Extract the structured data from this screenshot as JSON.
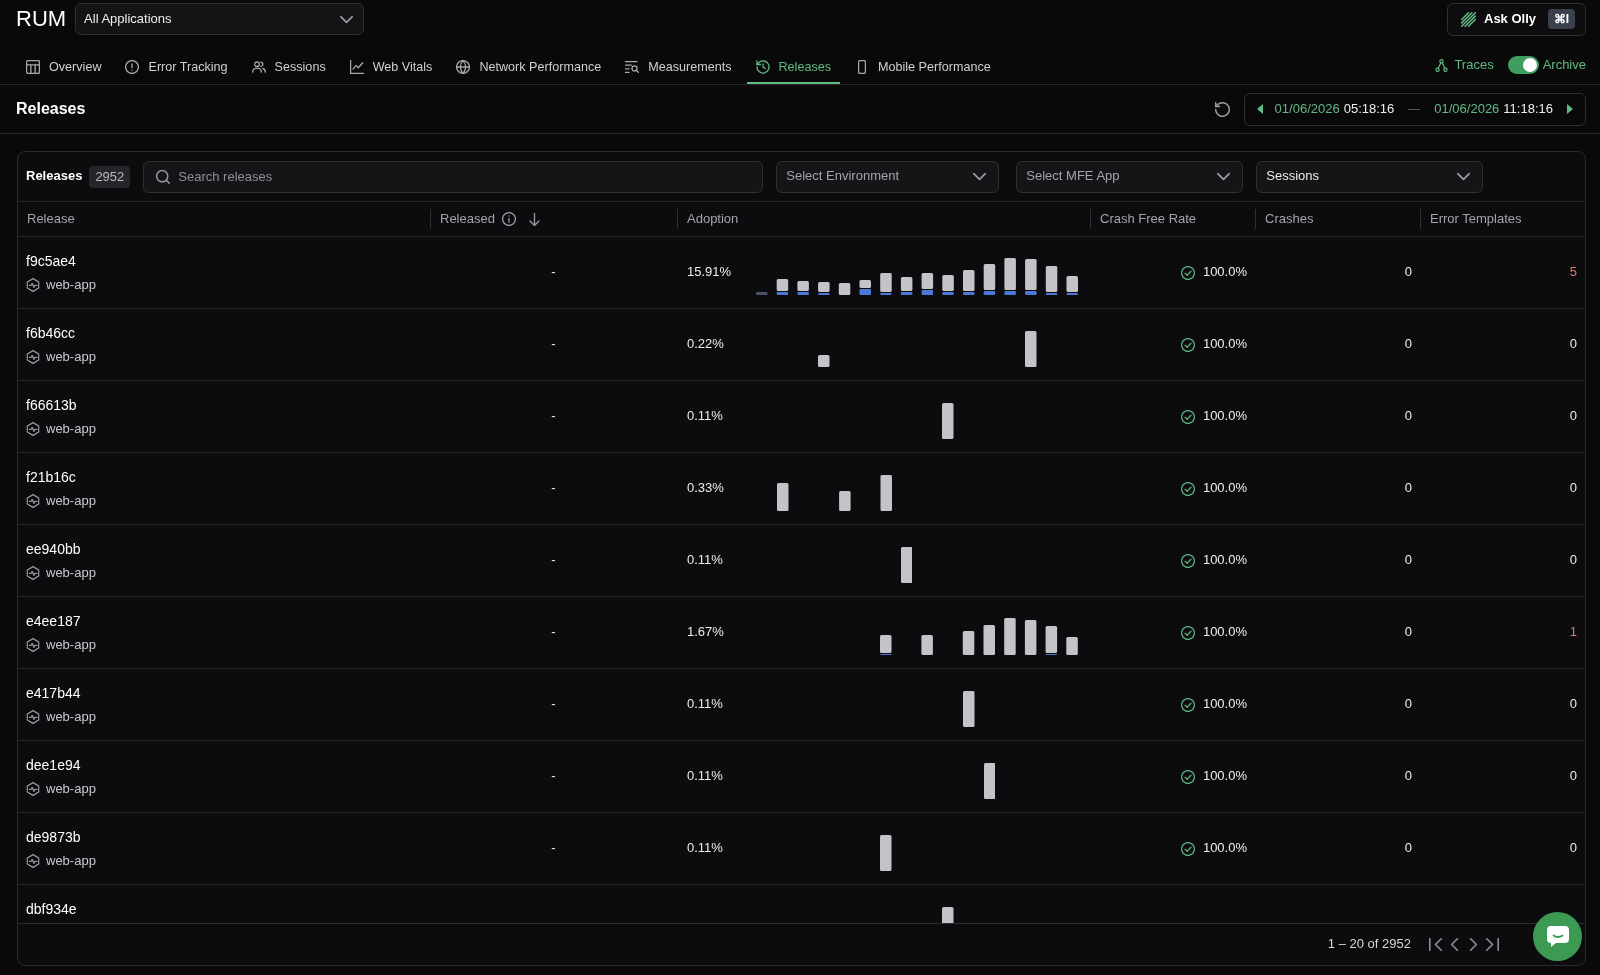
{
  "header": {
    "title": "RUM",
    "application_select": {
      "value": "All Applications"
    },
    "ask_button": {
      "label": "Ask Olly",
      "shortcut": "⌘I"
    }
  },
  "tabs": [
    {
      "label": "Overview",
      "selected": false
    },
    {
      "label": "Error Tracking",
      "selected": false
    },
    {
      "label": "Sessions",
      "selected": false
    },
    {
      "label": "Web Vitals",
      "selected": false
    },
    {
      "label": "Network Performance",
      "selected": false
    },
    {
      "label": "Measurements",
      "selected": false
    },
    {
      "label": "Releases",
      "selected": true
    },
    {
      "label": "Mobile Performance",
      "selected": false
    }
  ],
  "tab_bar_actions": {
    "traces": {
      "label": "Traces"
    },
    "archive": {
      "label": "Archive",
      "on": true
    }
  },
  "page_header": {
    "title": "Releases",
    "time_range": {
      "start_date": "01/06/2026",
      "start_time": "05:18:16",
      "end_date": "01/06/2026",
      "end_time": "11:18:16"
    }
  },
  "releases_panel": {
    "label": "Releases",
    "count": "2952",
    "search": {
      "placeholder": "Search releases"
    },
    "filters": [
      {
        "placeholder": "Select Environment"
      },
      {
        "placeholder": "Select MFE App"
      },
      {
        "value": "Sessions"
      }
    ],
    "table": {
      "columns": [
        {
          "label": "Release"
        },
        {
          "label": "Released",
          "info": true,
          "sorted_descending": true
        },
        {
          "label": "Adoption"
        },
        {
          "label": "Crash Free Rate"
        },
        {
          "label": "Crashes"
        },
        {
          "label": "Error Templates"
        }
      ],
      "rows": [
        {
          "release": "f9c5ae4",
          "app": "web-app",
          "released": "-",
          "adoption": "15.91%",
          "crash_free_rate": "100.0%",
          "crashes": "0",
          "error_templates": "5",
          "error_templates_alert": true
        },
        {
          "release": "f6b46cc",
          "app": "web-app",
          "released": "-",
          "adoption": "0.22%",
          "crash_free_rate": "100.0%",
          "crashes": "0",
          "error_templates": "0",
          "error_templates_alert": false
        },
        {
          "release": "f66613b",
          "app": "web-app",
          "released": "-",
          "adoption": "0.11%",
          "crash_free_rate": "100.0%",
          "crashes": "0",
          "error_templates": "0",
          "error_templates_alert": false
        },
        {
          "release": "f21b16c",
          "app": "web-app",
          "released": "-",
          "adoption": "0.33%",
          "crash_free_rate": "100.0%",
          "crashes": "0",
          "error_templates": "0",
          "error_templates_alert": false
        },
        {
          "release": "ee940bb",
          "app": "web-app",
          "released": "-",
          "adoption": "0.11%",
          "crash_free_rate": "100.0%",
          "crashes": "0",
          "error_templates": "0",
          "error_templates_alert": false
        },
        {
          "release": "e4ee187",
          "app": "web-app",
          "released": "-",
          "adoption": "1.67%",
          "crash_free_rate": "100.0%",
          "crashes": "0",
          "error_templates": "1",
          "error_templates_alert": true
        },
        {
          "release": "e417b44",
          "app": "web-app",
          "released": "-",
          "adoption": "0.11%",
          "crash_free_rate": "100.0%",
          "crashes": "0",
          "error_templates": "0",
          "error_templates_alert": false
        },
        {
          "release": "dee1e94",
          "app": "web-app",
          "released": "-",
          "adoption": "0.11%",
          "crash_free_rate": "100.0%",
          "crashes": "0",
          "error_templates": "0",
          "error_templates_alert": false
        },
        {
          "release": "de9873b",
          "app": "web-app",
          "released": "-",
          "adoption": "0.11%",
          "crash_free_rate": "100.0%",
          "crashes": "0",
          "error_templates": "0",
          "error_templates_alert": false
        },
        {
          "release": "dbf934e"
        }
      ]
    },
    "pagination": {
      "range": "1 – 20 of 2952"
    }
  }
}
